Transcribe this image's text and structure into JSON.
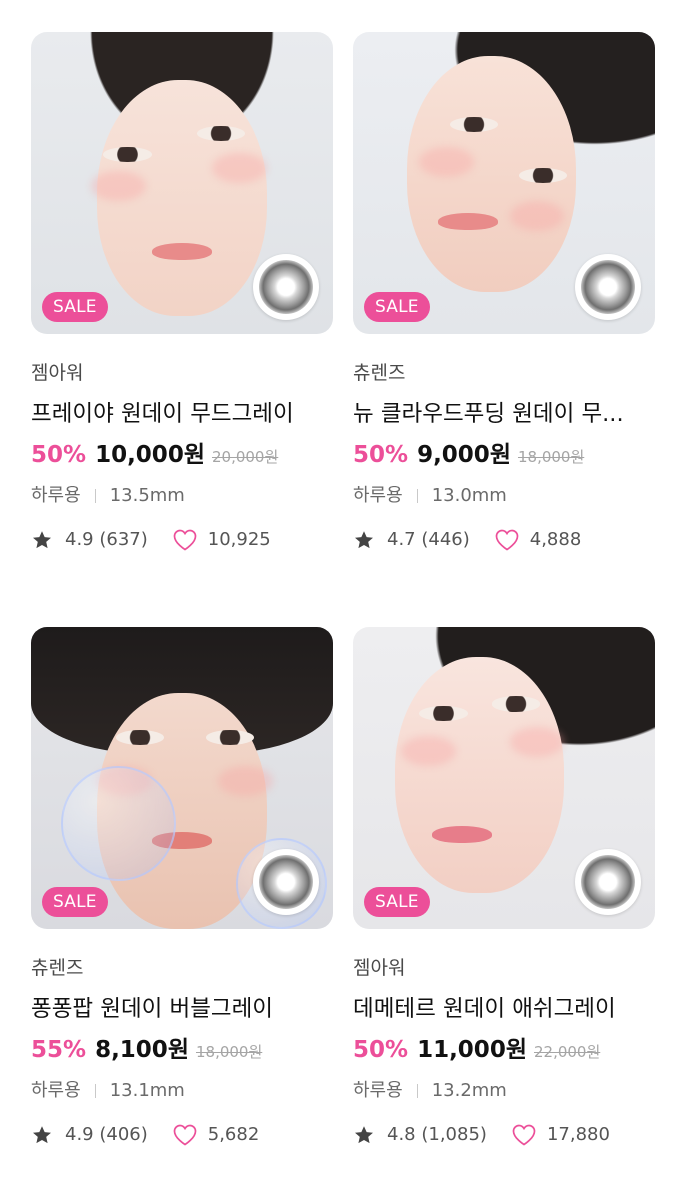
{
  "colors": {
    "accent": "#ec4f99",
    "text": "#111111",
    "muted": "#6a6a6a",
    "strike": "#a5a5a5"
  },
  "products": [
    {
      "sale_badge": "SALE",
      "brand": "젬아워",
      "title": "프레이야 원데이 무드그레이",
      "discount": "50%",
      "price": "10,000원",
      "original_price": "20,000원",
      "usage": "하루용",
      "diameter": "13.5mm",
      "rating": "4.9 (637)",
      "likes": "10,925",
      "icons": [
        "star-icon",
        "heart-icon",
        "lens-icon"
      ]
    },
    {
      "sale_badge": "SALE",
      "brand": "츄렌즈",
      "title": "뉴 클라우드푸딩 원데이 무...",
      "discount": "50%",
      "price": "9,000원",
      "original_price": "18,000원",
      "usage": "하루용",
      "diameter": "13.0mm",
      "rating": "4.7 (446)",
      "likes": "4,888",
      "icons": [
        "star-icon",
        "heart-icon",
        "lens-icon"
      ]
    },
    {
      "sale_badge": "SALE",
      "brand": "츄렌즈",
      "title": "퐁퐁팝 원데이 버블그레이",
      "discount": "55%",
      "price": "8,100원",
      "original_price": "18,000원",
      "usage": "하루용",
      "diameter": "13.1mm",
      "rating": "4.9 (406)",
      "likes": "5,682",
      "icons": [
        "star-icon",
        "heart-icon",
        "lens-icon"
      ]
    },
    {
      "sale_badge": "SALE",
      "brand": "젬아워",
      "title": "데메테르 원데이 애쉬그레이",
      "discount": "50%",
      "price": "11,000원",
      "original_price": "22,000원",
      "usage": "하루용",
      "diameter": "13.2mm",
      "rating": "4.8 (1,085)",
      "likes": "17,880",
      "icons": [
        "star-icon",
        "heart-icon",
        "lens-icon"
      ]
    }
  ]
}
